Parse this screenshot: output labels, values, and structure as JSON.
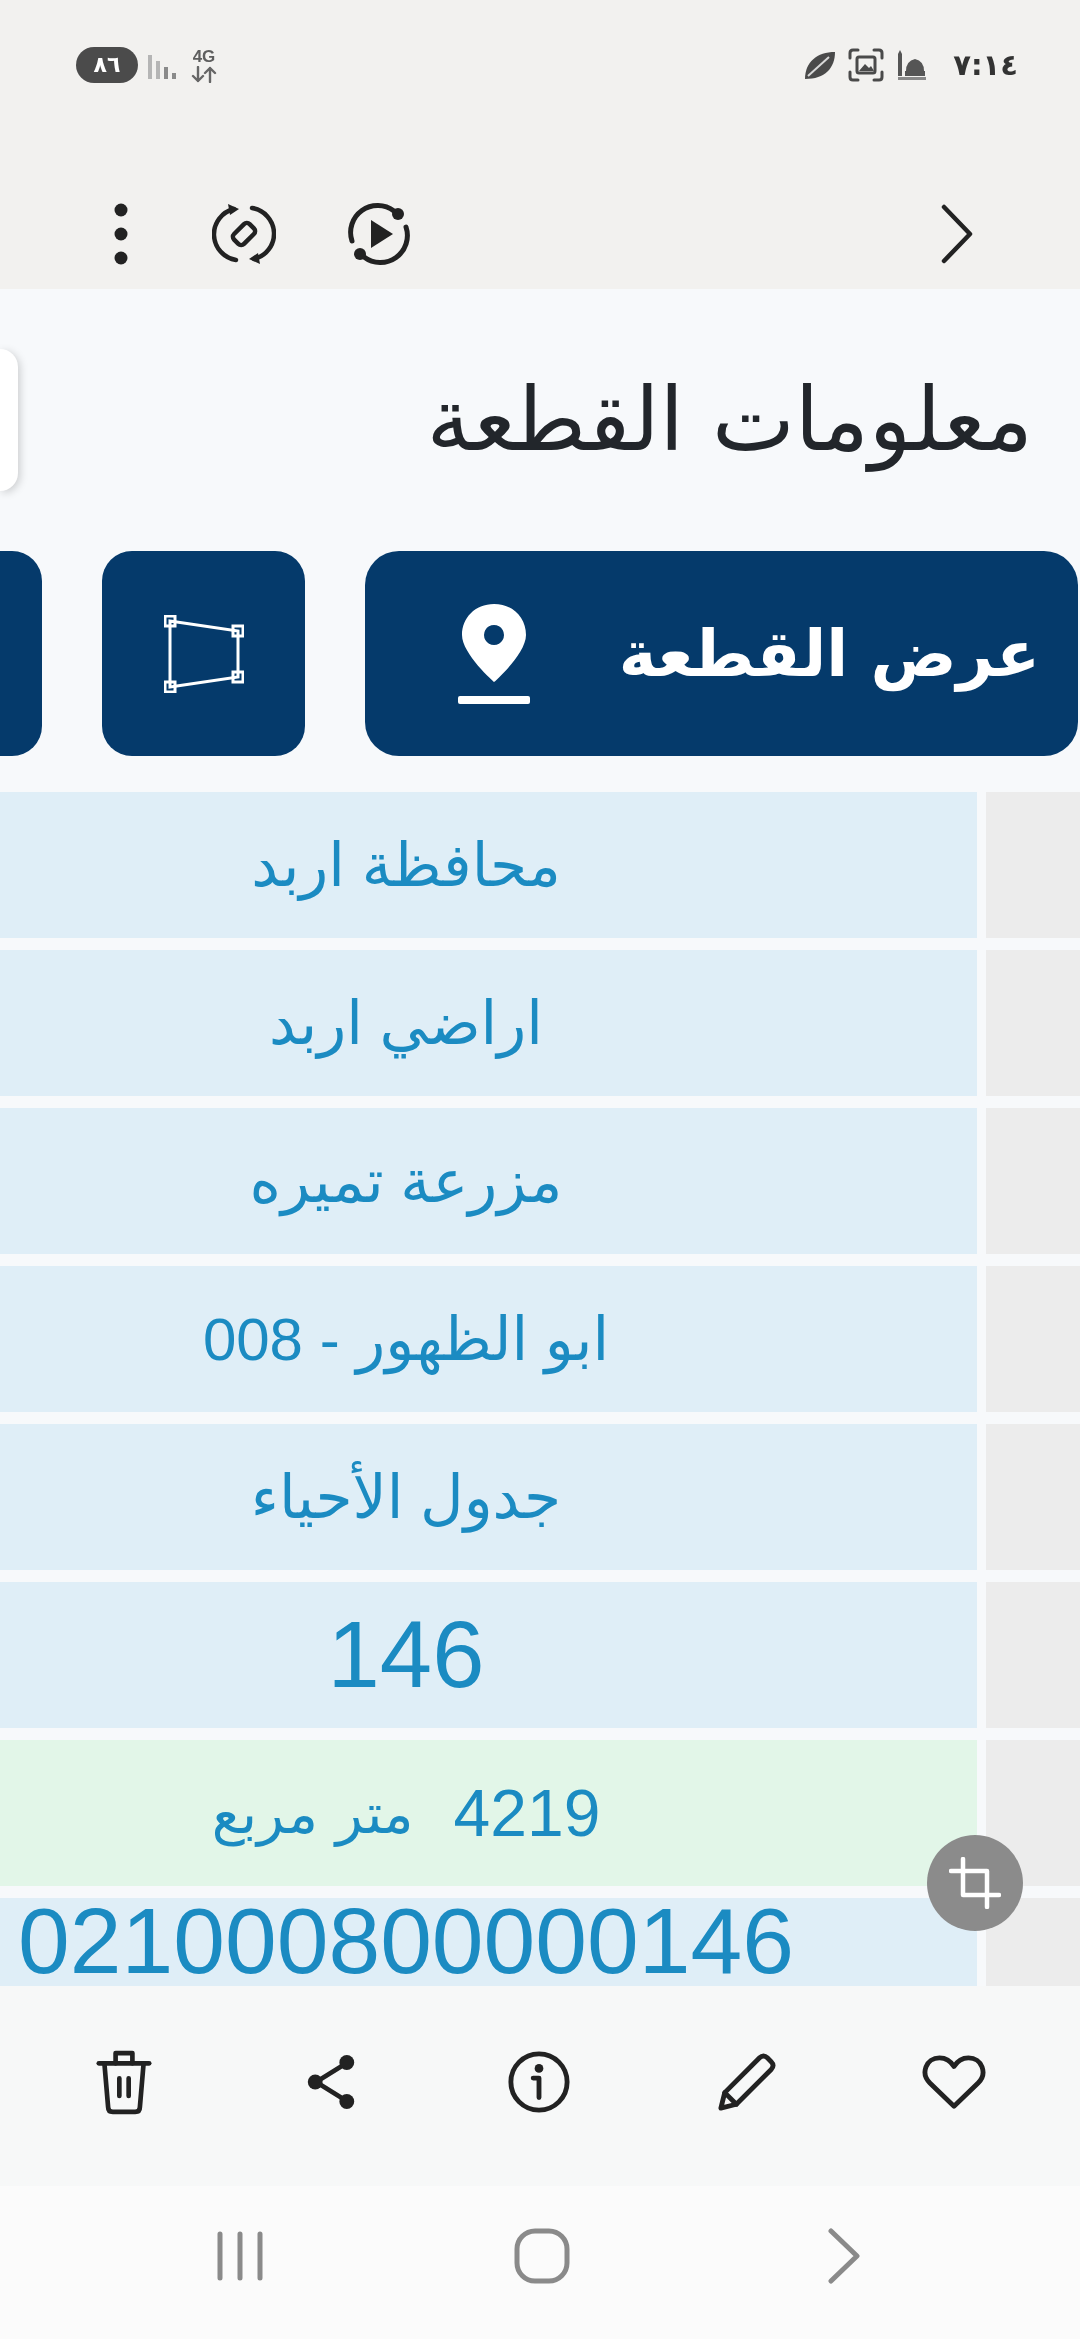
{
  "status_bar": {
    "battery": "٨٦",
    "network": "4G",
    "time": "٧:١٤"
  },
  "page": {
    "title": "معلومات القطعة",
    "actions": [
      {
        "kind": "labeled",
        "label": "عرض القطعة"
      },
      {
        "kind": "polygon"
      },
      {
        "kind": "clipped"
      }
    ]
  },
  "table": {
    "rows": [
      {
        "kind": "text",
        "value": "محافظة اربد"
      },
      {
        "kind": "text",
        "value": "اراضي اربد"
      },
      {
        "kind": "text",
        "value": "مزرعة تميره"
      },
      {
        "kind": "text",
        "value": "ابو الظهور - 008"
      },
      {
        "kind": "text",
        "value": "جدول الأحياء"
      },
      {
        "kind": "number",
        "value": "146"
      },
      {
        "kind": "area",
        "value": "4219",
        "unit": "متر مربع"
      },
      {
        "kind": "code",
        "value": "021000800000146"
      }
    ]
  }
}
